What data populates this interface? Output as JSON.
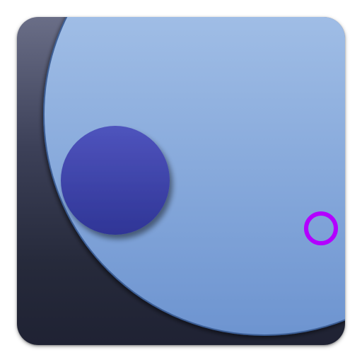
{
  "icon": {
    "semantic": "launcher-app-icon",
    "colors": {
      "tile_top": "#6a6e87",
      "tile_bottom": "#1f2233",
      "disc_top": "#b3cdee",
      "disc_bottom": "#6d94d0",
      "disc_rim": "#3c5e96",
      "dot_top": "#4f54bd",
      "dot_bottom": "#2f3596",
      "ring": "#b300ff"
    }
  }
}
